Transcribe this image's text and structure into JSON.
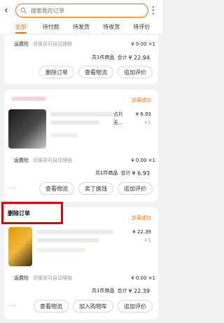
{
  "search": {
    "placeholder": "搜索我的订单"
  },
  "tabs": [
    {
      "label": "全部"
    },
    {
      "label": "待付款"
    },
    {
      "label": "待发货"
    },
    {
      "label": "待收货"
    },
    {
      "label": "待评价"
    }
  ],
  "card1": {
    "shipping_label": "运费险",
    "shipping_note": "退换货可自动理赔",
    "shipping_value": "¥ 0.00 ×1",
    "total_prefix": "共1件商品",
    "total_mid": "合计",
    "total_value": "¥ 22.94",
    "buttons": [
      "删除订单",
      "查看物流",
      "追加评价"
    ]
  },
  "card2": {
    "status": "交易成功",
    "title_fragment": "占片",
    "title_fragment2": "无...",
    "price": "¥ 6.93",
    "qty": "×1",
    "shipping_label": "运费险",
    "shipping_note": "退换货可自动理赔",
    "shipping_value": "¥ 0.00 ×1",
    "total_prefix": "共1件商品",
    "total_mid": "合计",
    "total_value": "¥ 6.93",
    "buttons": [
      "查看物流",
      "卖了换钱",
      "追加评价"
    ]
  },
  "card3": {
    "status": "交易成功",
    "price": "¥ 22.39",
    "qty": "×1",
    "shipping_label": "运费险",
    "shipping_note": "退换货可自动理赔",
    "shipping_value": "¥ 0.00 ×1",
    "total_prefix": "共1件商品",
    "total_mid": "合计",
    "total_value": "¥ 22.39",
    "buttons": [
      "查看物流",
      "加入购物车",
      "追加评价"
    ]
  },
  "popup": {
    "label": "删除订单"
  },
  "colors": {
    "accent": "#ff6a00",
    "highlight": "#e00000"
  }
}
